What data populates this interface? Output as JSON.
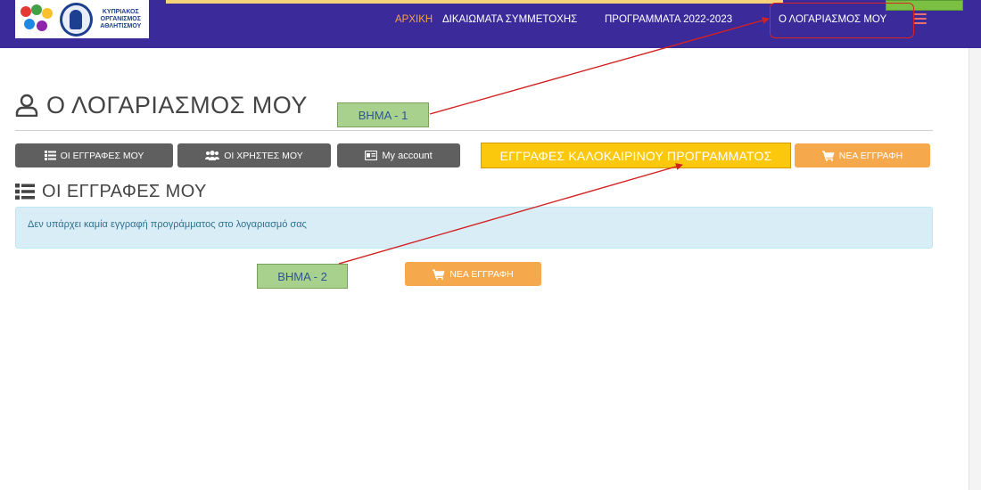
{
  "header": {
    "logo_text": "ΚΥΠΡΙΑΚΟΣ\nΟΡΓΑΝΙΣΜΟΣ\nΑΘΛΗΤΙΣΜΟΥ",
    "nav": {
      "home": "ΑΡΧΙΚΗ",
      "rights": "ΔΙΚΑΙΩΜΑΤΑ ΣΥΜΜΕΤΟΧΗΣ",
      "programs": "ΠΡΟΓΡΑΜΜΑΤΑ 2022-2023",
      "account": "Ο ΛΟΓΑΡΙΑΣΜΟΣ ΜΟΥ"
    }
  },
  "page": {
    "title": "Ο ΛΟΓΑΡΙΑΣΜΟΣ ΜΟΥ",
    "section_title": "ΟΙ ΕΓΓΡΑΦΕΣ ΜΟΥ",
    "alert_text": "Δεν υπάρχει καμία εγγραφή προγράμματος στο λογαριασμό σας"
  },
  "tabs": {
    "registrations": "ΟΙ ΕΓΓΡΑΦΕΣ ΜΟΥ",
    "users": "ΟΙ ΧΡΗΣΤΕΣ ΜΟΥ",
    "my_account": "My account",
    "new_registration": "ΝΕΑ ΕΓΓΡΑΦΗ"
  },
  "summer_label": "ΕΓΓΡΑΦΕΣ ΚΑΛΟΚΑΙΡΙΝΟΥ ΠΡΟΓΡΑΜΜΑΤΟΣ",
  "new_registration_button": "ΝΕΑ ΕΓΓΡΑΦΗ",
  "annotations": {
    "step1": "ΒΗΜΑ - 1",
    "step2": "ΒΗΜΑ - 2"
  },
  "colors": {
    "header_bg": "#3b2a9a",
    "nav_home": "#f5a04a",
    "button_dark": "#5f5f5f",
    "button_orange": "#f5a94c",
    "summer_label_bg": "#fcc80e",
    "step_bg": "#a9d18e",
    "alert_bg": "#d9edf7",
    "arrow": "#d22222"
  }
}
